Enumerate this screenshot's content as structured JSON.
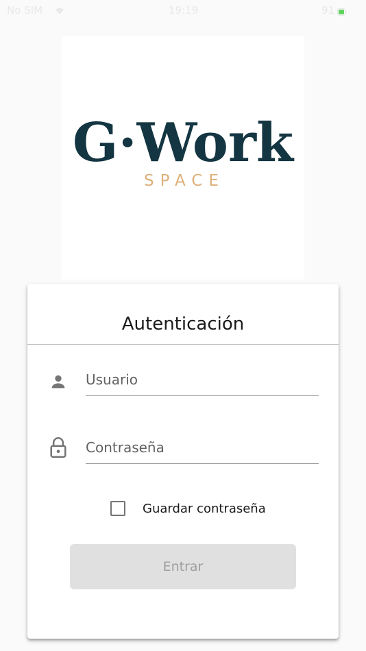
{
  "status_bar": {
    "carrier": "No SIM",
    "time": "19:19",
    "battery_percent": "91"
  },
  "logo": {
    "brand": "G·Work",
    "tagline": "SPACE",
    "colors": {
      "brand": "#143542",
      "tagline": "#ddb07a"
    }
  },
  "auth": {
    "title": "Autenticación",
    "username_placeholder": "Usuario",
    "password_placeholder": "Contraseña",
    "remember_label": "Guardar contraseña",
    "remember_checked": false,
    "submit_label": "Entrar",
    "icons": {
      "username": "person-icon",
      "password": "lock-icon"
    }
  }
}
